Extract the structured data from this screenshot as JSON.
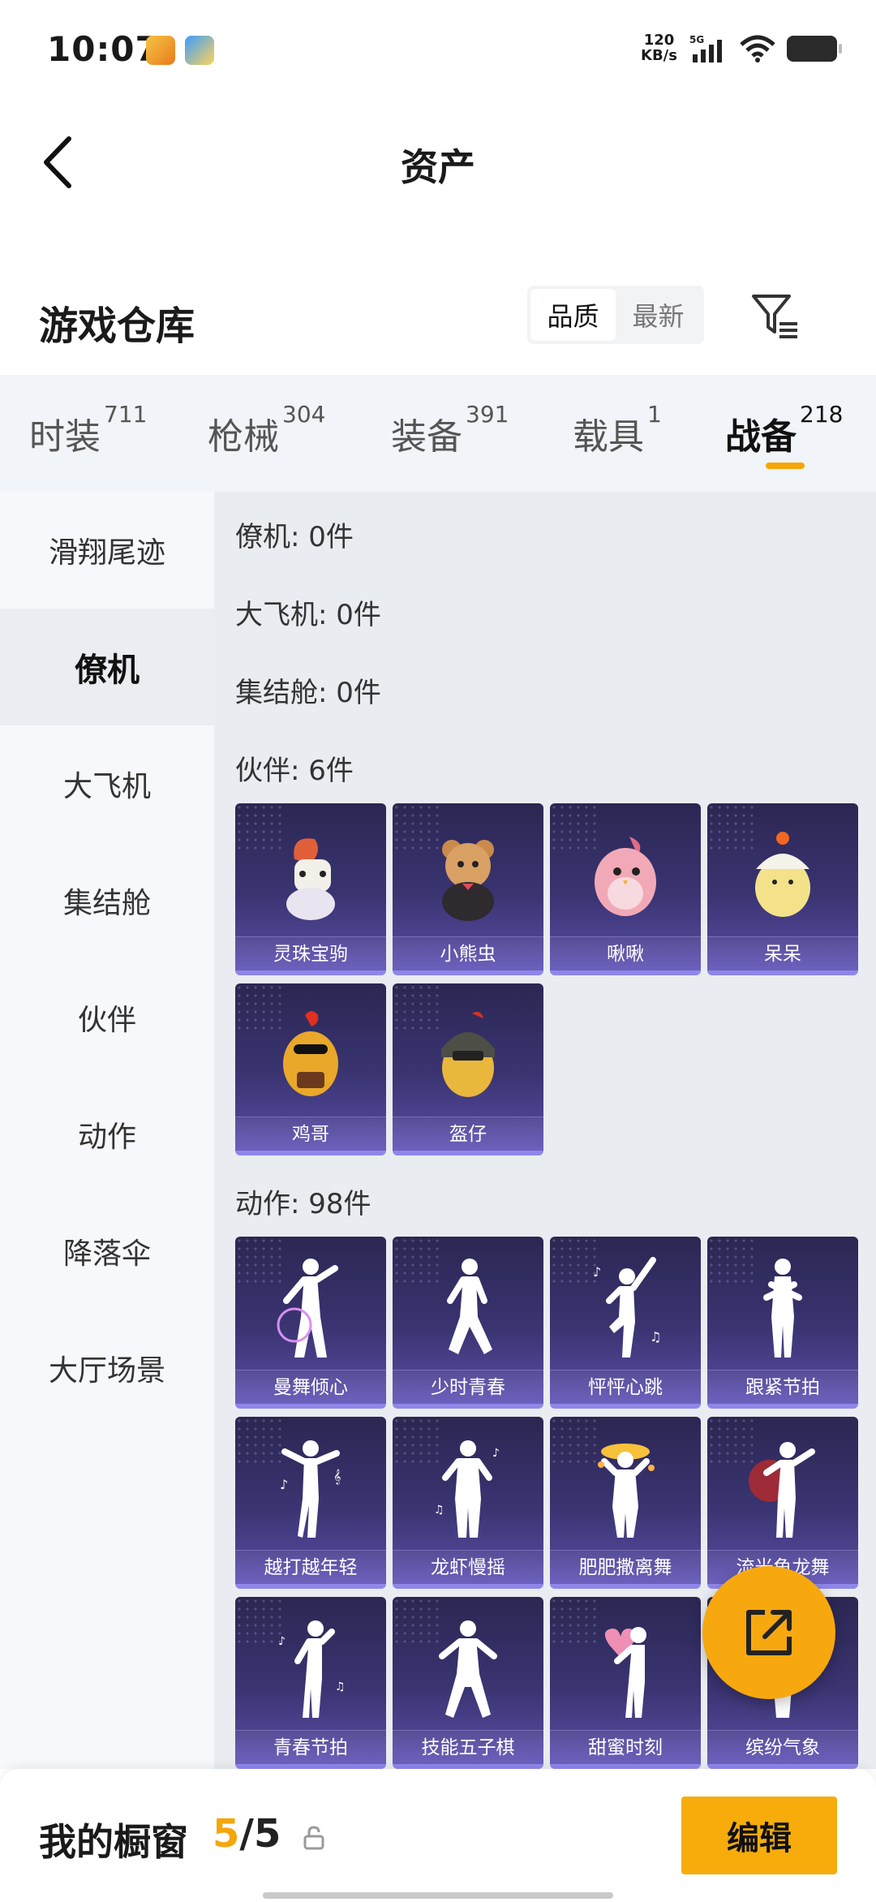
{
  "status_bar": {
    "time": "10:07",
    "speed_value": "120",
    "speed_unit": "KB/s",
    "network": "5G"
  },
  "header": {
    "title": "资产"
  },
  "warehouse": {
    "title": "游戏仓库",
    "sort_options": [
      "品质",
      "最新"
    ],
    "sort_selected": "品质"
  },
  "tabs": [
    {
      "label": "时装",
      "count": "711"
    },
    {
      "label": "枪械",
      "count": "304"
    },
    {
      "label": "装备",
      "count": "391"
    },
    {
      "label": "载具",
      "count": "1"
    },
    {
      "label": "战备",
      "count": "218"
    }
  ],
  "active_tab": "战备",
  "side_nav": [
    "滑翔尾迹",
    "僚机",
    "大飞机",
    "集结舱",
    "伙伴",
    "动作",
    "降落伞",
    "大厅场景"
  ],
  "active_side": "僚机",
  "sections": {
    "wingman": "僚机: 0件",
    "plane": "大飞机: 0件",
    "pod": "集结舱: 0件",
    "partner": "伙伴: 6件",
    "emote": "动作: 98件"
  },
  "partners": [
    "灵珠宝驹",
    "小熊虫",
    "啾啾",
    "呆呆",
    "鸡哥",
    "盔仔"
  ],
  "emotes": [
    "曼舞倾心",
    "少时青春",
    "怦怦心跳",
    "跟紧节拍",
    "越打越年轻",
    "龙虾慢摇",
    "肥肥撒离舞",
    "流光龟龙舞",
    "青春节拍",
    "技能五子棋",
    "甜蜜时刻",
    "缤纷气象"
  ],
  "bottom_bar": {
    "label": "我的橱窗",
    "current": "5",
    "separator": "/",
    "total": "5",
    "edit_label": "编辑"
  },
  "colors": {
    "accent": "#f7ac0c",
    "card_bg": "#3a3472",
    "tab_underline": "#f5a60a"
  }
}
